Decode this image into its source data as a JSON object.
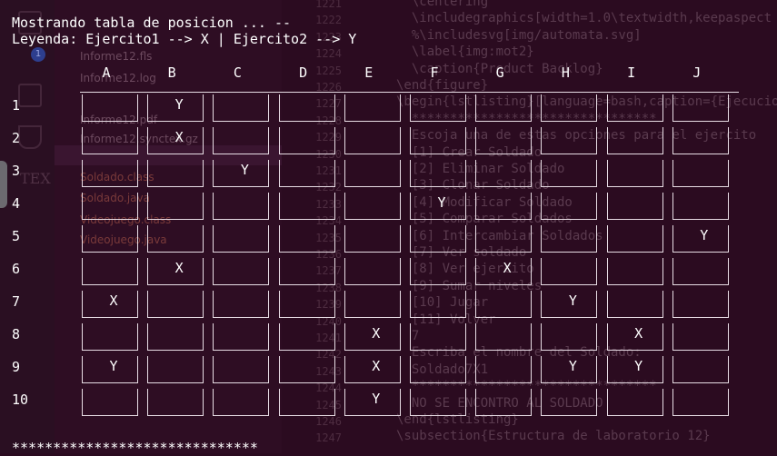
{
  "background_editor": {
    "explorer_items": [
      {
        "label": "Informe12.fls",
        "kind": "file"
      },
      {
        "label": "Informe12.log",
        "kind": "file"
      },
      {
        "label": "Informe12.pdf",
        "kind": "pdf"
      },
      {
        "label": "Informe12.synctex.gz",
        "kind": "file"
      },
      {
        "label": "Soldado.class",
        "kind": "java"
      },
      {
        "label": "Soldado.java",
        "kind": "java"
      },
      {
        "label": "Videojuego.class",
        "kind": "java"
      },
      {
        "label": "Videojuego.java",
        "kind": "java"
      }
    ],
    "line_numbers": [
      "1221",
      "1222",
      "1223",
      "1224",
      "1225",
      "1226",
      "1227",
      "1228",
      "1229",
      "1230",
      "1231",
      "1232",
      "1233",
      "1234",
      "1235",
      "1236",
      "1237",
      "1238",
      "1239",
      "1240",
      "1241",
      "1242",
      "1243",
      "1244",
      "1245",
      "1246",
      "1247"
    ],
    "code_lines": [
      "  \\centering",
      "  \\includegraphics[width=1.0\\textwidth,keepaspect",
      "  %\\includesvg[img/automata.svg]",
      "  \\label{img:mot2}",
      "  \\caption{Product Backlog}",
      "\\end{figure}",
      "\\begin{lstlisting}[language=bash,caption={Ejecucio",
      "  ********************************",
      "  Escoja una de estas opciones para el ejercito",
      "  [1] Crear Soldado",
      "  [2] Eliminar Soldado",
      "  [3] Clonar Soldado",
      "  [4] Modificar Soldado",
      "  [5] Comparar Soldados",
      "  [6] Intercambiar Soldados",
      "  [7] Ver soldado",
      "  [8] Ver ejercito",
      "  [9] Sumar niveles",
      "  [10] Jugar",
      "  [11] Volver",
      "  7",
      "  Escriba el nombre del Soldado:",
      "  Soldado7X1",
      "  ********************************",
      "  NO SE ENCONTRO AL SOLDADO",
      "\\end{lstlisting}",
      "\\subsection{Estructura de laboratorio 12}"
    ],
    "badge_count": "1",
    "tex_label": "TEX"
  },
  "terminal": {
    "line1": "Mostrando tabla de posicion ... --",
    "line2": "Leyenda: Ejercito1 --> X | Ejercito2 --> Y",
    "columns": [
      "A",
      "B",
      "C",
      "D",
      "E",
      "F",
      "G",
      "H",
      "I",
      "J"
    ],
    "rows": [
      "1",
      "2",
      "3",
      "4",
      "5",
      "6",
      "7",
      "8",
      "9",
      "10"
    ],
    "board": [
      [
        "",
        "Y",
        "",
        "",
        "",
        "",
        "",
        "",
        "",
        ""
      ],
      [
        "",
        "X",
        "",
        "",
        "",
        "",
        "",
        "",
        "",
        ""
      ],
      [
        "",
        "",
        "Y",
        "",
        "",
        "",
        "",
        "",
        "",
        ""
      ],
      [
        "",
        "",
        "",
        "",
        "",
        "Y",
        "",
        "",
        "",
        ""
      ],
      [
        "",
        "",
        "",
        "",
        "",
        "",
        "",
        "",
        "",
        "Y"
      ],
      [
        "",
        "X",
        "",
        "",
        "",
        "",
        "X",
        "",
        "",
        ""
      ],
      [
        "X",
        "",
        "",
        "",
        "",
        "",
        "",
        "Y",
        "",
        ""
      ],
      [
        "",
        "",
        "",
        "",
        "X",
        "",
        "",
        "",
        "X",
        ""
      ],
      [
        "Y",
        "",
        "",
        "",
        "X",
        "",
        "",
        "Y",
        "Y",
        ""
      ],
      [
        "",
        "",
        "",
        "",
        "Y",
        "",
        "",
        "",
        "",
        ""
      ]
    ],
    "footer": "******************************"
  },
  "colors": {
    "terminal_bg": "#2b0b20",
    "text": "#ffffff"
  }
}
